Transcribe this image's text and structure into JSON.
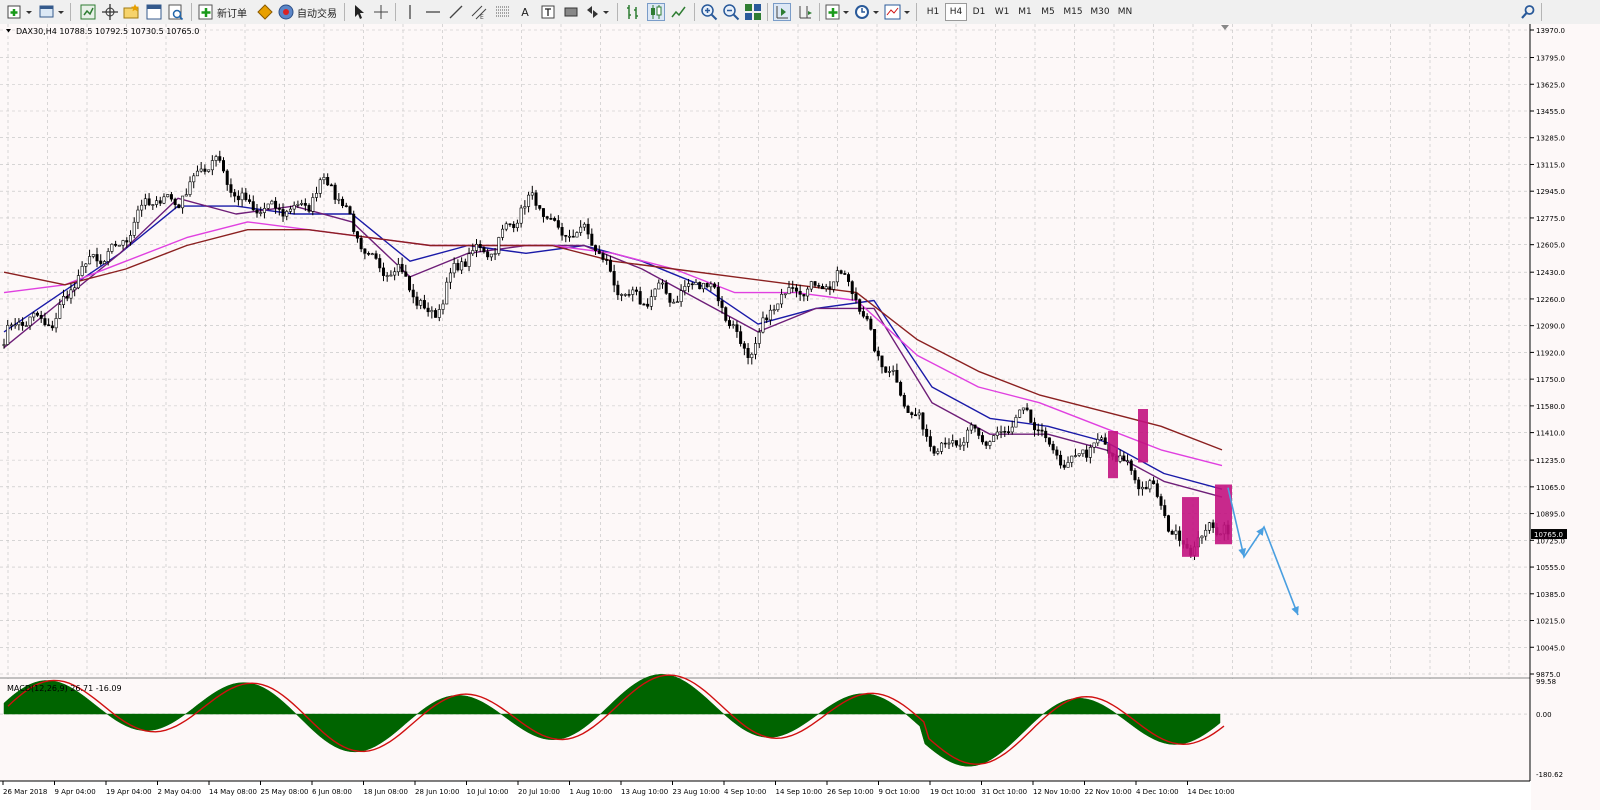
{
  "toolbar": {
    "new_order_label": "新订单",
    "auto_trading_label": "自动交易",
    "tool_text_label": "A",
    "timeframes": [
      {
        "label": "H1",
        "active": false
      },
      {
        "label": "H4",
        "active": true
      },
      {
        "label": "D1",
        "active": false
      },
      {
        "label": "W1",
        "active": false
      },
      {
        "label": "M1",
        "active": false
      },
      {
        "label": "M5",
        "active": false
      },
      {
        "label": "M15",
        "active": false
      },
      {
        "label": "M30",
        "active": false
      },
      {
        "label": "MN",
        "active": false
      }
    ]
  },
  "chart": {
    "header": "DAX30,H4  10788.5 10792.5 10730.5 10765.0",
    "current_price_label": "10765.0",
    "price_ticks": [
      "13970.0",
      "13795.0",
      "13625.0",
      "13455.0",
      "13285.0",
      "13115.0",
      "12945.0",
      "12775.0",
      "12605.0",
      "12430.0",
      "12260.0",
      "12090.0",
      "11920.0",
      "11750.0",
      "11580.0",
      "11410.0",
      "11235.0",
      "11065.0",
      "10895.0",
      "10725.0",
      "10555.0",
      "10385.0",
      "10215.0",
      "10045.0",
      "9875.0"
    ],
    "time_ticks": [
      "26 Mar 2018",
      "9 Apr 04:00",
      "19 Apr 04:00",
      "2 May 04:00",
      "14 May 08:00",
      "25 May 08:00",
      "6 Jun 08:00",
      "18 Jun 08:00",
      "28 Jun 10:00",
      "10 Jul 10:00",
      "20 Jul 10:00",
      "1 Aug 10:00",
      "13 Aug 10:00",
      "23 Aug 10:00",
      "4 Sep 10:00",
      "14 Sep 10:00",
      "26 Sep 10:00",
      "9 Oct 10:00",
      "19 Oct 10:00",
      "31 Oct 10:00",
      "12 Nov 10:00",
      "22 Nov 10:00",
      "4 Dec 10:00",
      "14 Dec 10:00"
    ],
    "colors": {
      "background": "#fdf8f8",
      "grid": "#c0c0c0",
      "candle": "#000000",
      "ma_blue": "#1a1aa8",
      "ma_purple": "#6e1e78",
      "ma_magenta": "#e040e0",
      "ma_brown": "#8b2020",
      "highlight": "#c2127f",
      "arrow": "#4a9fe0",
      "macd_hist": "#006400",
      "macd_signal": "#d01010"
    }
  },
  "macd": {
    "header": "MACD(12,26,9) 26.71 -16.09",
    "max_label": "99.58",
    "zero_label": "0.00",
    "min_label": "-180.62"
  },
  "chart_data": {
    "type": "candlestick",
    "symbol": "DAX30",
    "timeframe": "H4",
    "last_bar": {
      "open": 10788.5,
      "high": 10792.5,
      "low": 10730.5,
      "close": 10765.0
    },
    "ylim": [
      9875.0,
      13970.0
    ],
    "price_path": [
      [
        "26 Mar 2018",
        12000
      ],
      [
        "9 Apr 04:00",
        12200
      ],
      [
        "19 Apr 04:00",
        12600
      ],
      [
        "2 May 04:00",
        12900
      ],
      [
        "14 May 08:00",
        13100
      ],
      [
        "25 May 08:00",
        12750
      ],
      [
        "6 Jun 08:00",
        13000
      ],
      [
        "18 Jun 08:00",
        12500
      ],
      [
        "28 Jun 10:00",
        12200
      ],
      [
        "10 Jul 10:00",
        12600
      ],
      [
        "20 Jul 10:00",
        12850
      ],
      [
        "1 Aug 10:00",
        12600
      ],
      [
        "13 Aug 10:00",
        12200
      ],
      [
        "23 Aug 10:00",
        12400
      ],
      [
        "4 Sep 10:00",
        11950
      ],
      [
        "14 Sep 10:00",
        12400
      ],
      [
        "26 Sep 10:00",
        12300
      ],
      [
        "9 Oct 10:00",
        11500
      ],
      [
        "19 Oct 10:00",
        11300
      ],
      [
        "31 Oct 10:00",
        11500
      ],
      [
        "12 Nov 10:00",
        11250
      ],
      [
        "22 Nov 10:00",
        11300
      ],
      [
        "4 Dec 10:00",
        10750
      ],
      [
        "14 Dec 10:00",
        10765
      ]
    ],
    "moving_averages": [
      {
        "color": "#1a1aa8",
        "values": [
          12050,
          12300,
          12550,
          12850,
          12850,
          12800,
          12800,
          12500,
          12600,
          12550,
          12600,
          12500,
          12350,
          12100,
          12200,
          12250,
          11700,
          11500,
          11450,
          11350,
          11150,
          11050
        ]
      },
      {
        "color": "#6e1e78",
        "values": [
          11950,
          12250,
          12550,
          12900,
          12800,
          12850,
          12750,
          12400,
          12550,
          12600,
          12600,
          12450,
          12250,
          12050,
          12200,
          12200,
          11600,
          11400,
          11400,
          11300,
          11100,
          11000
        ]
      },
      {
        "color": "#e040e0",
        "values": [
          12300,
          12350,
          12500,
          12650,
          12750,
          12700,
          12650,
          12600,
          12600,
          12600,
          12550,
          12450,
          12300,
          12300,
          12250,
          11900,
          11700,
          11600,
          11450,
          11300,
          11200
        ]
      },
      {
        "color": "#8b2020",
        "values": [
          12430,
          12350,
          12450,
          12600,
          12700,
          12700,
          12650,
          12600,
          12600,
          12600,
          12500,
          12450,
          12400,
          12350,
          12300,
          12000,
          11800,
          11650,
          11550,
          11450,
          11300
        ]
      }
    ],
    "macd": {
      "fast": 12,
      "slow": 26,
      "signal": 9,
      "values": [
        26.71,
        -16.09
      ],
      "ylim": [
        -180.62,
        99.58
      ]
    }
  }
}
